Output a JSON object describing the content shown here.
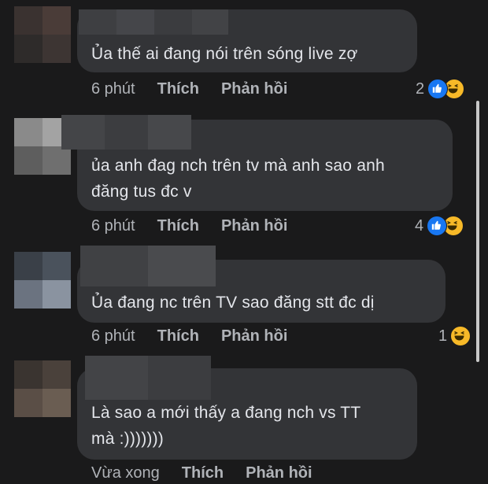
{
  "comments": [
    {
      "text": "Ủa thế ai đang nói trên sóng live zợ",
      "time": "6 phút",
      "like_label": "Thích",
      "reply_label": "Phản hồi",
      "reaction_count": "2",
      "reactions": [
        "like-icon",
        "haha-icon"
      ]
    },
    {
      "text": "ủa anh đag nch trên tv mà anh sao anh\nđăng tus đc v",
      "time": "6 phút",
      "like_label": "Thích",
      "reply_label": "Phản hồi",
      "reaction_count": "4",
      "reactions": [
        "like-icon",
        "haha-icon"
      ]
    },
    {
      "text": "Ủa đang nc trên TV sao đăng stt đc dị",
      "time": "6 phút",
      "like_label": "Thích",
      "reply_label": "Phản hồi",
      "reaction_count": "1",
      "reactions": [
        "haha-icon"
      ]
    },
    {
      "text": "Là sao a mới thấy a đang nch vs TT\nmà :)))))))",
      "time": "Vừa xong",
      "like_label": "Thích",
      "reply_label": "Phản hồi"
    }
  ],
  "colors": {
    "background": "#1a1a1b",
    "bubble": "#333437",
    "text": "#e4e6eb",
    "muted": "#b0b3b8",
    "like_blue": "#1877f2",
    "haha_yellow": "#f7b928"
  }
}
